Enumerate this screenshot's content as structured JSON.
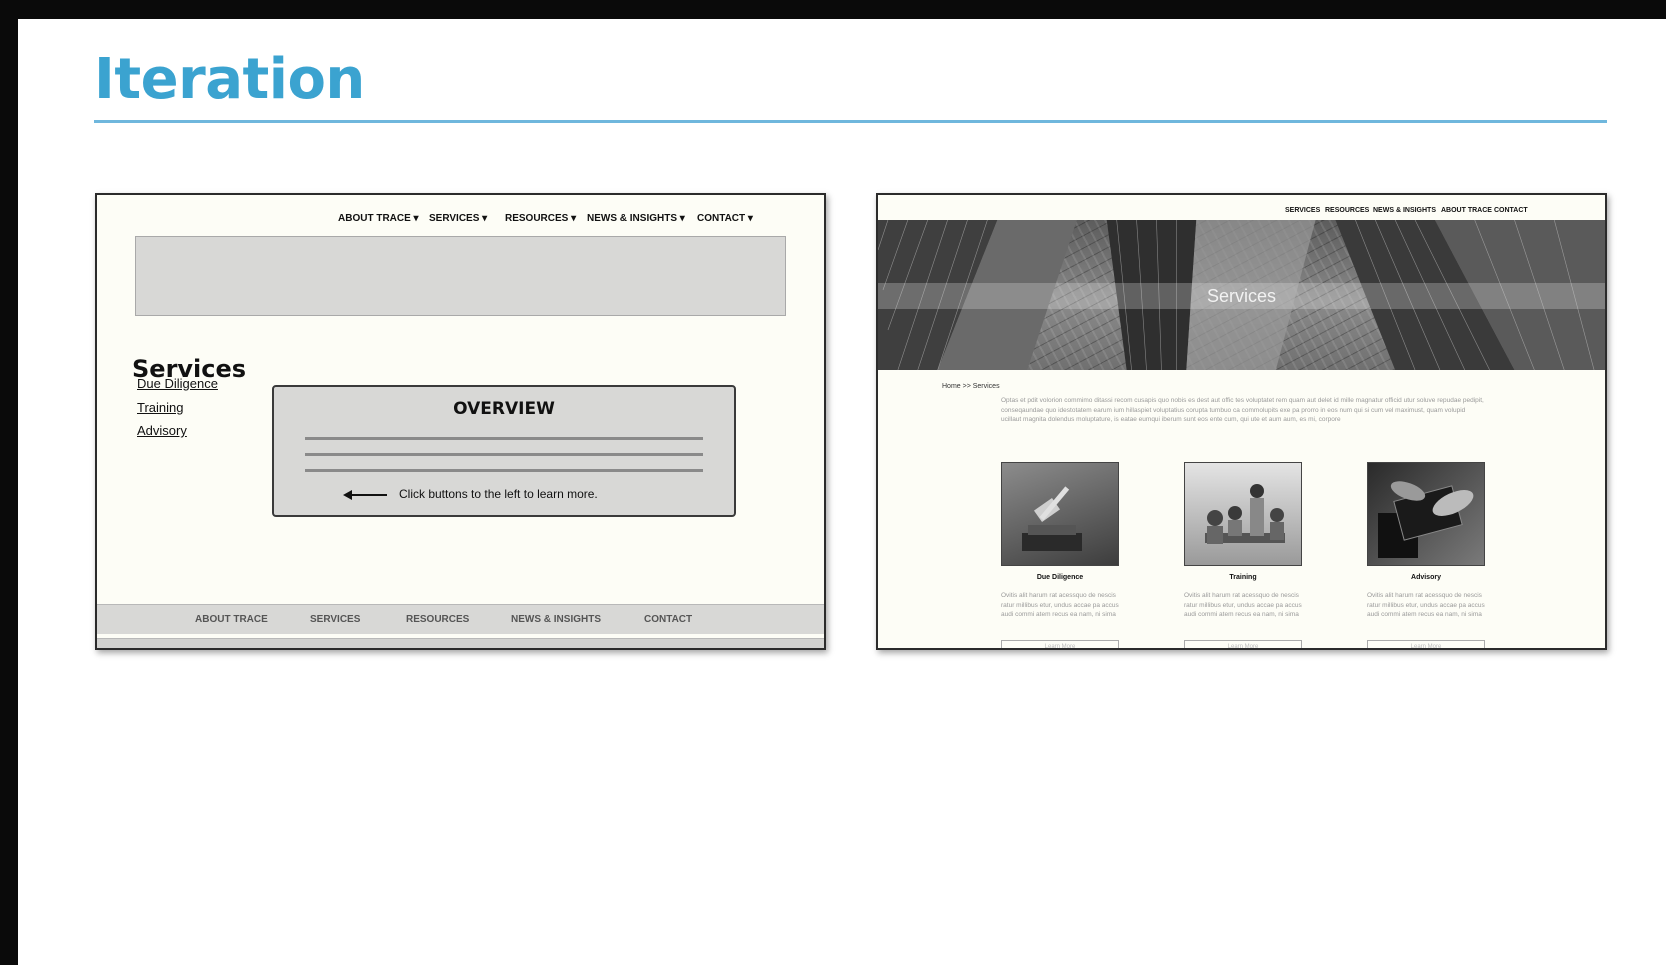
{
  "slide": {
    "title": "Iteration"
  },
  "wireframe": {
    "nav": [
      "ABOUT TRACE ▾",
      "SERVICES ▾",
      "RESOURCES ▾",
      "NEWS & INSIGHTS ▾",
      "CONTACT ▾"
    ],
    "heading": "Services",
    "links": [
      "Due Diligence",
      "Training",
      "Advisory"
    ],
    "overview_title": "OVERVIEW",
    "hint": "Click buttons to the left to learn more.",
    "footer": [
      "ABOUT TRACE",
      "SERVICES",
      "RESOURCES",
      "NEWS & INSIGHTS",
      "CONTACT"
    ]
  },
  "mockup": {
    "nav": [
      "SERVICES",
      "RESOURCES",
      "NEWS & INSIGHTS",
      "ABOUT TRACE",
      "CONTACT"
    ],
    "hero_title": "Services",
    "breadcrumb": "Home >> Services",
    "intro": "Optas et pdit volorion commimo ditassi recom cusapis quo nobis es dest aut offic tes voluptatet rem quam aut delet id mille magnatur officid utur soluve repudae pedipit, conseqaundae quo idestotatem earum ium hillaspiet voluptatius corupta tumbuo ca commolupits exe pa prorro in eos num qui si cum vel maximust, quam volupid ucillaut magnita dolendus moluptature, is eatae eumqui iberum sunt eos ente cum, qui ute et aum aum, es mi, corpore",
    "cards": [
      {
        "title": "Due Diligence",
        "text": "Ovitis alit harum rat acessquo de nescis ratur millibus etur, undus accae pa accus audi commi atem recus ea nam, ni sima",
        "button": "Learn More"
      },
      {
        "title": "Training",
        "text": "Ovitis alit harum rat acessquo de nescis ratur millibus etur, undus accae pa accus audi commi atem recus ea nam, ni sima",
        "button": "Learn More"
      },
      {
        "title": "Advisory",
        "text": "Ovitis alit harum rat acessquo de nescis ratur millibus etur, undus accae pa accus audi commi atem recus ea nam, ni sima",
        "button": "Learn More"
      }
    ]
  }
}
